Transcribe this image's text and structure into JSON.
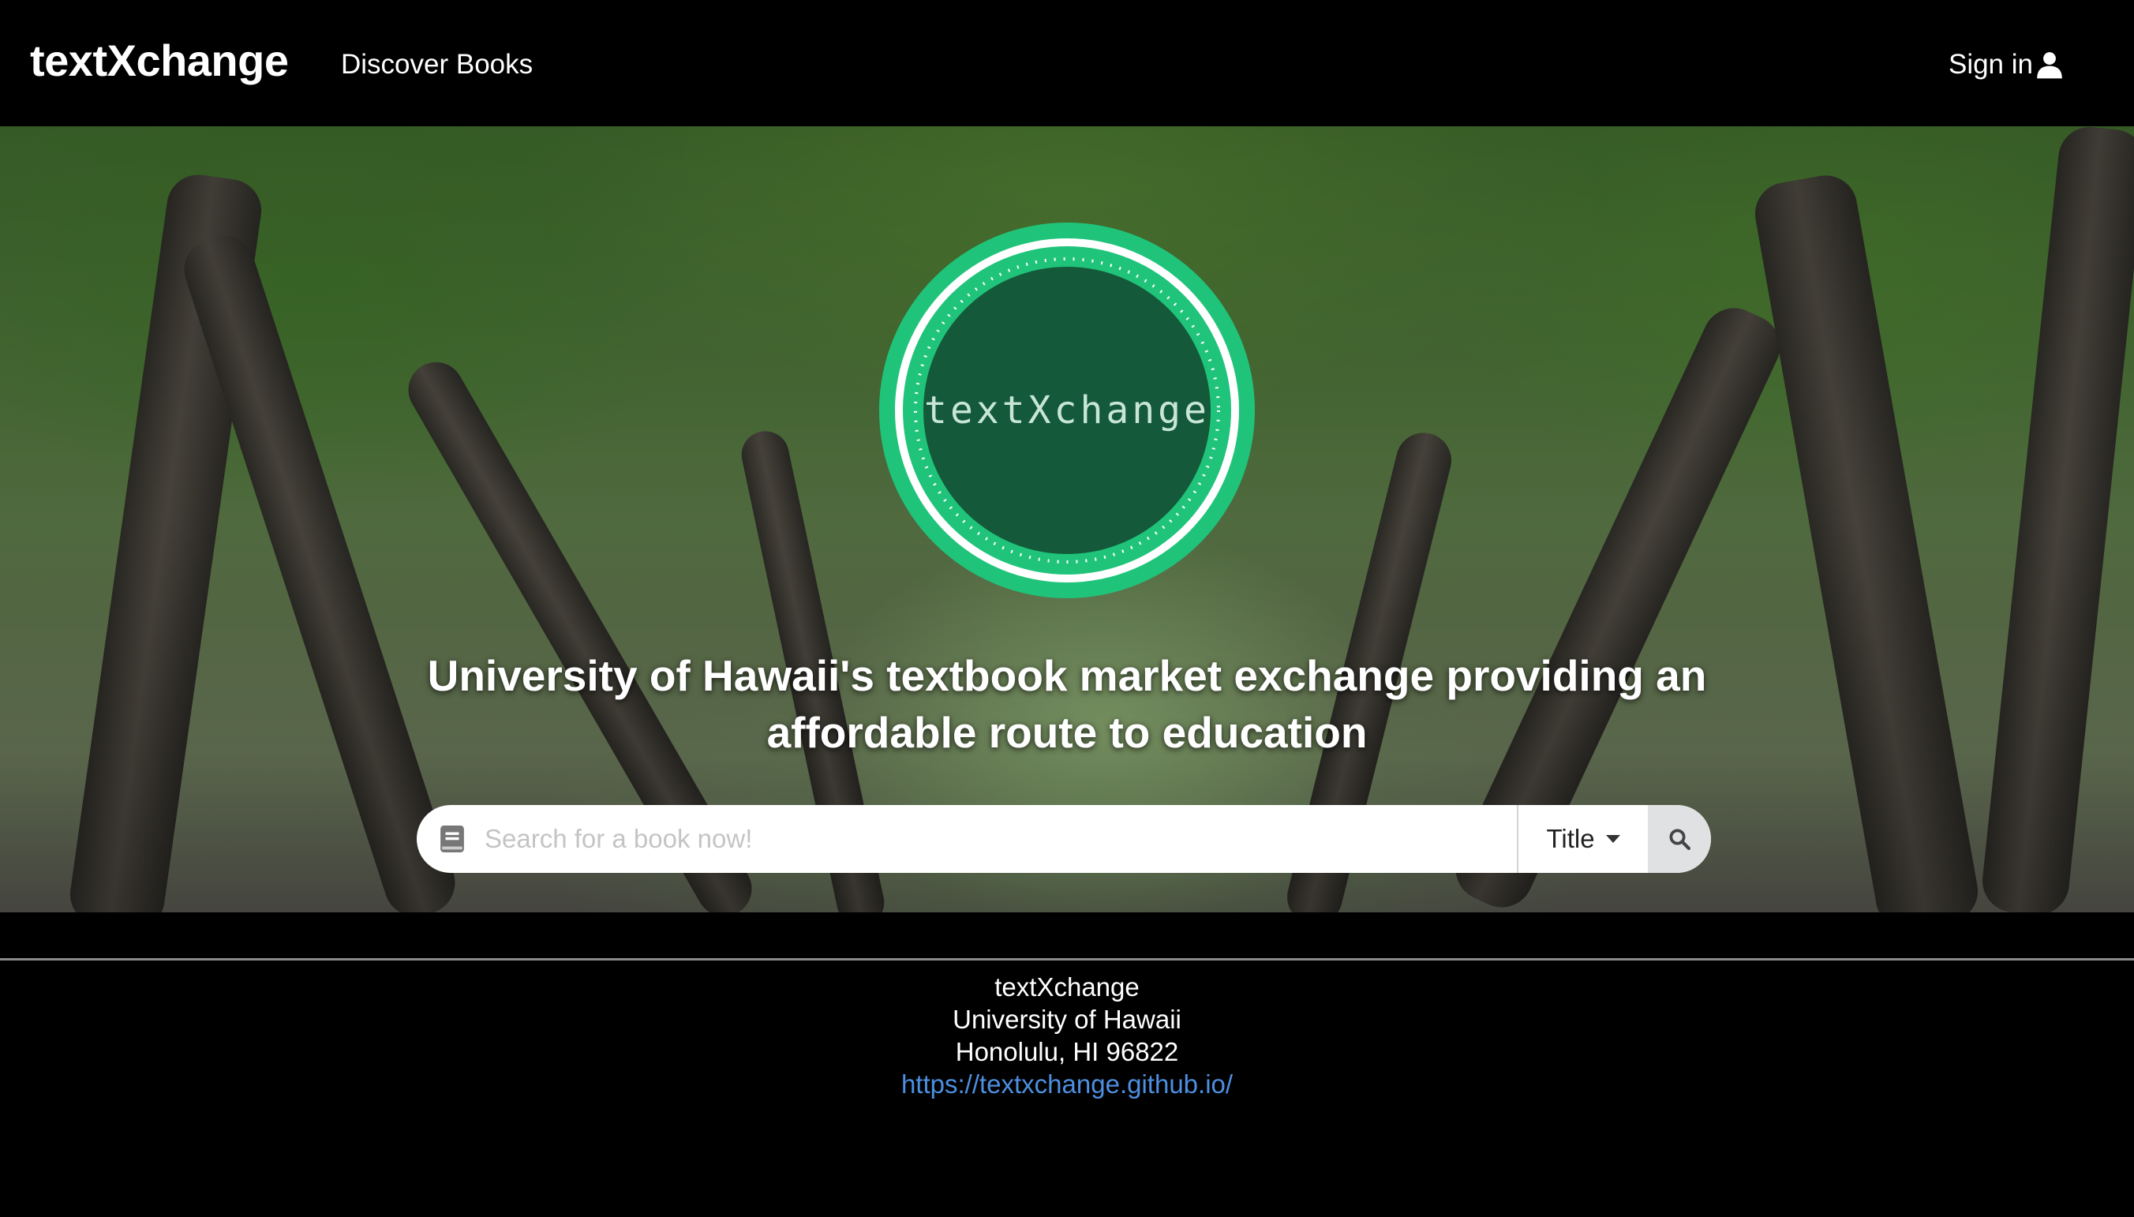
{
  "nav": {
    "brand": "textXchange",
    "discover_label": "Discover Books",
    "signin_label": "Sign in",
    "signin_icon": "user-icon"
  },
  "hero": {
    "logo_text": "textXchange",
    "headline": "University of Hawaii's textbook market exchange providing an affordable route to education",
    "search": {
      "placeholder": "Search for a book now!",
      "value": "",
      "left_icon": "book-icon",
      "filter_selected": "Title",
      "button_icon": "search-icon"
    }
  },
  "footer": {
    "line1": "textXchange",
    "line2": "University of Hawaii",
    "line3": "Honolulu, HI 96822",
    "link": "https://textxchange.github.io/"
  },
  "colors": {
    "nav_bg": "#000000",
    "logo_green": "#1fc47a",
    "logo_dark": "#145a3a",
    "footer_link": "#4d8fe0"
  }
}
